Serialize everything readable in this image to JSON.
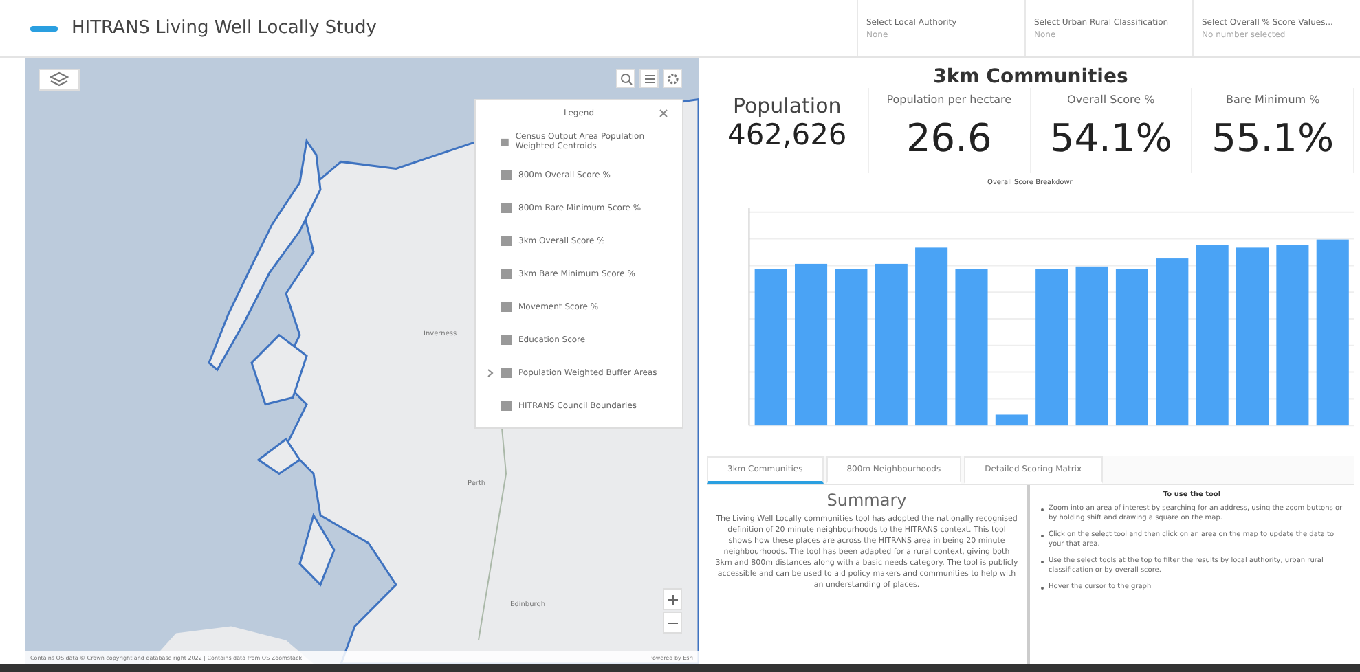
{
  "header": {
    "title": "HITRANS Living Well Locally Study",
    "filters": [
      {
        "label": "Select Local Authority",
        "value": "None"
      },
      {
        "label": "Select Urban Rural Classification",
        "value": "None"
      },
      {
        "label": "Select Overall % Score Values...",
        "value": "No number selected"
      }
    ]
  },
  "map": {
    "place_labels": [
      "Inverness",
      "Perth",
      "Edinburgh"
    ],
    "attribution": "Contains OS data © Crown copyright and database right 2022 | Contains data from OS Zoomstack",
    "powered_by": "Powered by Esri",
    "legend": {
      "title": "Legend",
      "items": [
        {
          "label": "Census Output Area Population Weighted Centroids",
          "expandable": false
        },
        {
          "label": "800m Overall Score %",
          "expandable": false
        },
        {
          "label": "800m Bare Minimum Score %",
          "expandable": false
        },
        {
          "label": "3km Overall Score %",
          "expandable": false
        },
        {
          "label": "3km Bare Minimum Score %",
          "expandable": false
        },
        {
          "label": "Movement Score %",
          "expandable": false
        },
        {
          "label": "Education Score",
          "expandable": false
        },
        {
          "label": "Population Weighted Buffer Areas",
          "expandable": true
        },
        {
          "label": "HITRANS Council Boundaries",
          "expandable": false
        }
      ]
    }
  },
  "dashboard": {
    "title": "3km Communities",
    "stats": [
      {
        "label": "Population",
        "value": "462,626"
      },
      {
        "label": "Population per hectare",
        "value": "26.6"
      },
      {
        "label": "Overall Score %",
        "value": "54.1%"
      },
      {
        "label": "Bare Minimum %",
        "value": "55.1%"
      }
    ],
    "chart_title": "Overall Score Breakdown",
    "tabs": [
      {
        "label": "3km Communities",
        "selected": true
      },
      {
        "label": "800m Neighbourhoods",
        "selected": false
      },
      {
        "label": "Detailed Scoring Matrix",
        "selected": false
      }
    ],
    "summary": {
      "title": "Summary",
      "text": "The Living Well Locally communities tool has adopted the nationally recognised definition of 20 minute neighbourhoods to the HITRANS context. This tool shows how these places are across the HITRANS area in being 20 minute neighbourhoods. The tool has been adapted for a rural context, giving both 3km and 800m distances along with a basic needs category. The tool is publicly accessible and can be used to aid policy makers and communities to help with an understanding of places."
    },
    "instructions": {
      "title": "To use the tool",
      "items": [
        "Zoom into an area of interest by searching for an address, using the zoom buttons or by holding shift and drawing a square on the map.",
        "Click on the select tool and then click on an area on the map to update the data to your that area.",
        "Use the select tools at the top to filter the results by local authority, urban rural classification or by overall score.",
        "Hover the cursor to the graph"
      ]
    }
  }
}
